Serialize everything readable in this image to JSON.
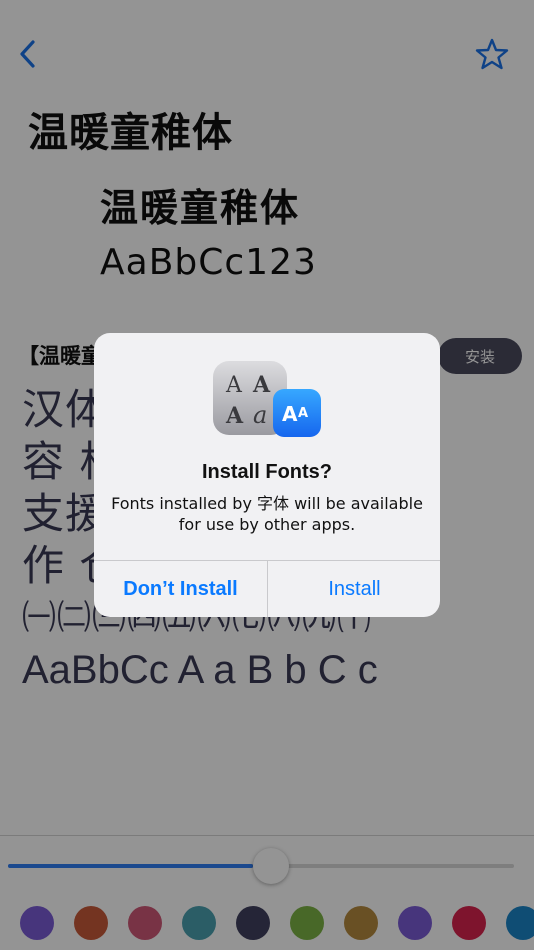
{
  "nav": {
    "back_icon": "chevron-left-icon",
    "favorite_icon": "star-outline-icon",
    "accent_color": "#1a73e8"
  },
  "page": {
    "title": "温暖童稚体"
  },
  "preview": {
    "line1": "温暖童稚体",
    "line2": "AaBbCc123"
  },
  "font_entry": {
    "name": "【温暖童",
    "install_label": "安装"
  },
  "sample": {
    "lines": [
      "汉体                              桂相",
      "容 析                            简单",
      "支援                              业制",
      "作 仓                            上网",
      "㈠㈡㈢㈣㈤㈥㈦㈧㈨㈩",
      "AaBbCc  A  a  B  b  C  c"
    ],
    "color": "#3a3a55"
  },
  "size_slider": {
    "value_fraction": 0.5
  },
  "swatches": [
    "#7b5cd6",
    "#c95a3a",
    "#cf5877",
    "#4aa0b0",
    "#404060",
    "#7cb445",
    "#b68a3e",
    "#7b5cd6",
    "#d9244e",
    "#1a86c9"
  ],
  "alert": {
    "icon": "fonts-app-icon",
    "title": "Install Fonts?",
    "message": "Fonts installed by 字体 will be available for use by other apps.",
    "cancel_label": "Don’t Install",
    "confirm_label": "Install"
  }
}
